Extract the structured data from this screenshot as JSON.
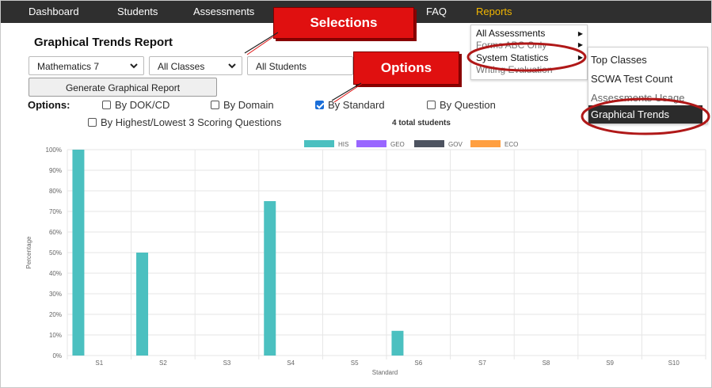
{
  "nav": {
    "items": [
      {
        "label": "Dashboard",
        "active": false
      },
      {
        "label": "Students",
        "active": false
      },
      {
        "label": "Assessments",
        "active": false
      },
      {
        "label": "FAQ",
        "active": false
      },
      {
        "label": "Reports",
        "active": true
      }
    ],
    "active_color": "#f2b600"
  },
  "page": {
    "title": "Graphical Trends Report",
    "selects": [
      {
        "value": "Mathematics 7",
        "icon": "chevron-down-icon"
      },
      {
        "value": "All Classes",
        "icon": "chevron-down-icon"
      },
      {
        "value": "All Students",
        "icon": "chevron-down-icon"
      }
    ],
    "generate_button": "Generate Graphical Report"
  },
  "options": {
    "label": "Options:",
    "items": [
      {
        "label": "By DOK/CD",
        "checked": false
      },
      {
        "label": "By Domain",
        "checked": false
      },
      {
        "label": "By Standard",
        "checked": true
      },
      {
        "label": "By Question",
        "checked": false
      },
      {
        "label": "By Highest/Lowest 3 Scoring Questions",
        "checked": false
      }
    ],
    "total_students": "4 total students"
  },
  "reports_menu": {
    "items": [
      {
        "label": "All Assessments",
        "has_submenu": true
      },
      {
        "label": "Forms ABC Only",
        "has_submenu": true
      },
      {
        "label": "System Statistics",
        "has_submenu": true
      },
      {
        "label": "Writing Evaluation",
        "has_submenu": false
      }
    ],
    "submenu": [
      {
        "label": "Top Classes",
        "highlighted": false
      },
      {
        "label": "SCWA Test Count",
        "highlighted": false
      },
      {
        "label": "Assessments Usage",
        "highlighted": false
      },
      {
        "label": "Graphical Trends",
        "highlighted": true
      }
    ]
  },
  "annotations": {
    "selections": "Selections",
    "options": "Options",
    "callout_color": "#e01010",
    "circle_color": "#b01818"
  },
  "chart_data": {
    "type": "bar",
    "title": "",
    "xlabel": "Standard",
    "ylabel": "Percentage",
    "categories": [
      "S1",
      "S2",
      "S3",
      "S4",
      "S5",
      "S6",
      "S7",
      "S8",
      "S9",
      "S10"
    ],
    "series": [
      {
        "name": "HIS",
        "color": "#4bc0c0",
        "values": [
          100,
          50,
          null,
          75,
          null,
          12,
          null,
          null,
          null,
          null
        ]
      },
      {
        "name": "GEO",
        "color": "#9966ff",
        "values": [
          null,
          null,
          null,
          null,
          null,
          null,
          null,
          null,
          null,
          null
        ]
      },
      {
        "name": "GOV",
        "color": "#4d5360",
        "values": [
          null,
          null,
          null,
          null,
          null,
          null,
          null,
          null,
          null,
          null
        ]
      },
      {
        "name": "ECO",
        "color": "#ff9f40",
        "values": [
          null,
          null,
          null,
          null,
          null,
          null,
          null,
          null,
          null,
          null
        ]
      }
    ],
    "ylim": [
      0,
      100
    ],
    "yticks": [
      "0%",
      "10%",
      "20%",
      "30%",
      "40%",
      "50%",
      "60%",
      "70%",
      "80%",
      "90%",
      "100%"
    ],
    "grid": true,
    "legend": "top-center"
  }
}
